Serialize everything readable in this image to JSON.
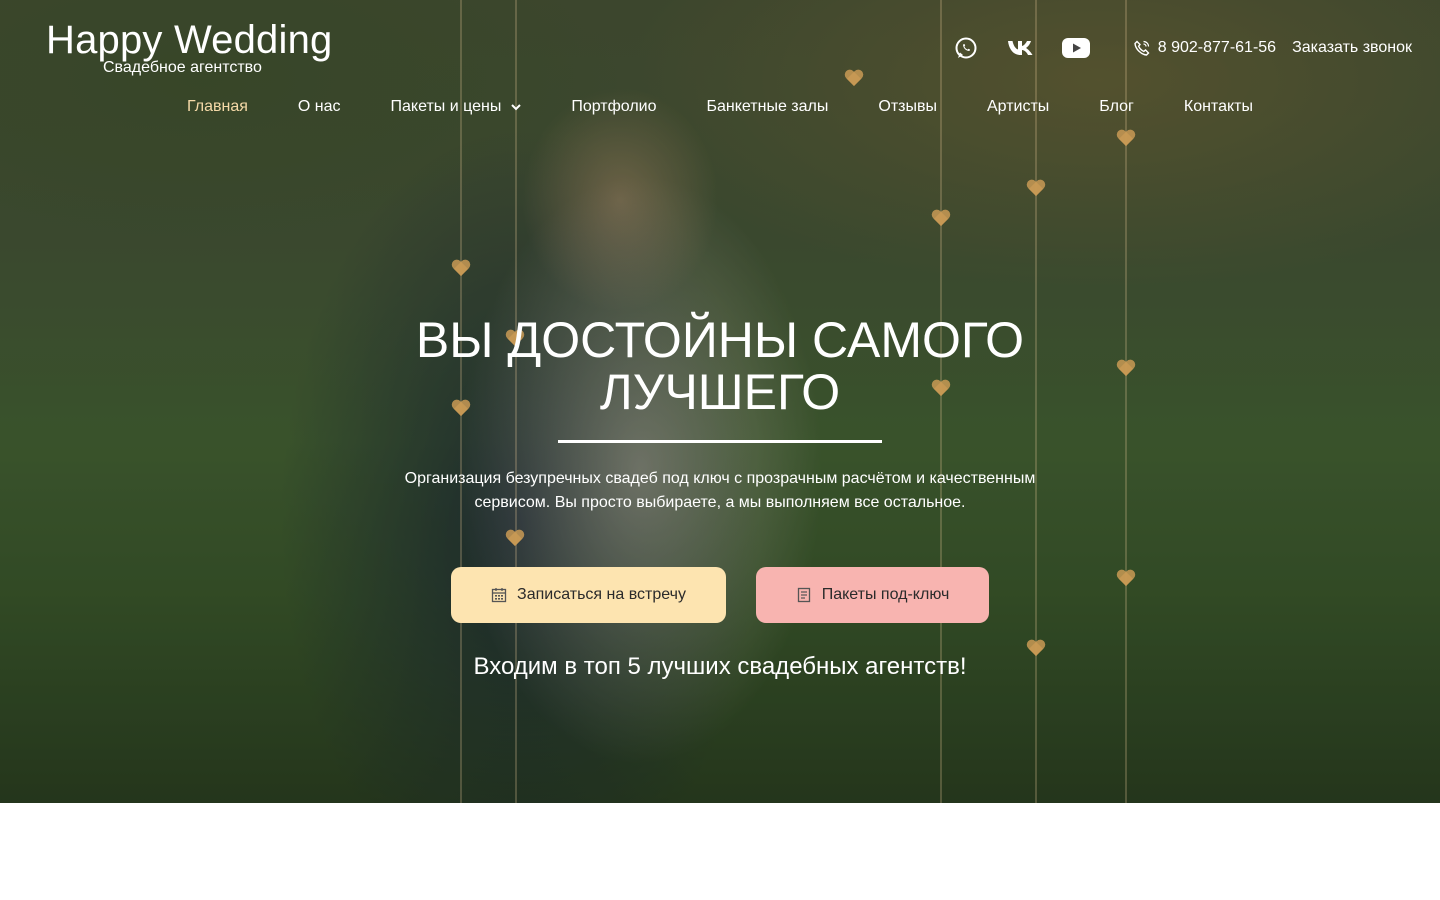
{
  "brand": {
    "title": "Happy Wedding",
    "subtitle": "Свадебное агентство"
  },
  "topbar": {
    "social": [
      "whatsapp-icon",
      "vk-icon",
      "youtube-icon"
    ],
    "phone": "8 902-877-61-56",
    "callback": "Заказать звонок"
  },
  "nav": {
    "items": [
      {
        "label": "Главная",
        "active": true
      },
      {
        "label": "О нас"
      },
      {
        "label": "Пакеты и цены",
        "dropdown": true
      },
      {
        "label": "Портфолио"
      },
      {
        "label": "Банкетные залы"
      },
      {
        "label": "Отзывы"
      },
      {
        "label": "Артисты"
      },
      {
        "label": "Блог"
      },
      {
        "label": "Контакты"
      }
    ]
  },
  "hero": {
    "headline": "ВЫ ДОСТОЙНЫ САМОГО ЛУЧШЕГО",
    "lead": "Организация безупречных свадеб под ключ с прозрачным расчётом и качественным сервисом. Вы просто выбираете, а мы выполняем все остальное.",
    "buttons": {
      "meeting": "Записаться на встречу",
      "packages": "Пакеты под-ключ"
    },
    "tagline": "Входим в топ 5 лучших свадебных агентств!"
  },
  "colors": {
    "accent_nav": "#f5d9a8",
    "button_meeting": "#fde4b0",
    "button_packages": "#f8b4b0"
  }
}
